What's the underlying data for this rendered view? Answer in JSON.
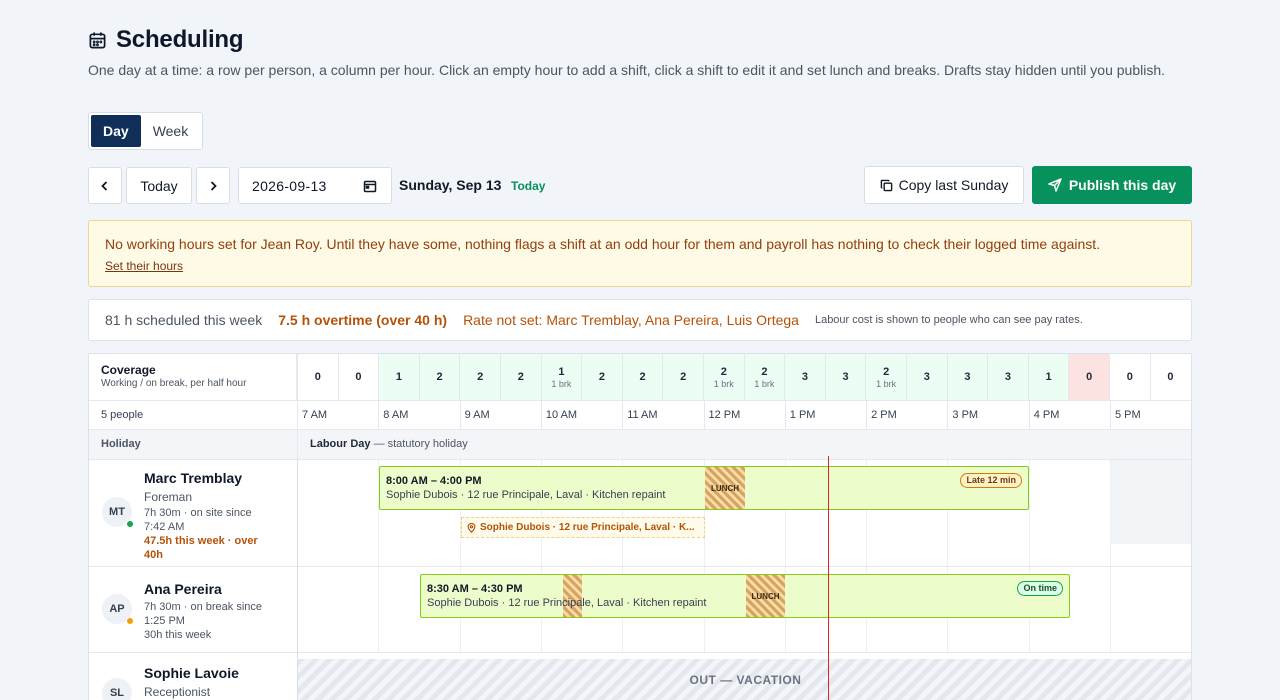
{
  "page": {
    "title": "Scheduling",
    "description": "One day at a time: a row per person, a column per hour. Click an empty hour to add a shift, click a shift to edit it and set lunch and breaks. Drafts stay hidden until you publish."
  },
  "view_toggle": {
    "day": "Day",
    "week": "Week",
    "selected": "Day"
  },
  "toolbar": {
    "today_label": "Today",
    "date_value": "2026-09-13",
    "date_label": "Sunday, Sep 13",
    "today_badge": "Today",
    "copy_label": "Copy last Sunday",
    "publish_label": "Publish this day"
  },
  "alert": {
    "message": "No working hours set for Jean Roy. Until they have some, nothing flags a shift at an odd hour for them and payroll has nothing to check their logged time against.",
    "link": "Set their hours"
  },
  "summary": {
    "scheduled": "81 h scheduled this week",
    "overtime": "7.5 h overtime (over 40 h)",
    "rate": "Rate not set: Marc Tremblay, Ana Pereira, Luis Ortega",
    "note": "Labour cost is shown to people who can see pay rates."
  },
  "coverage": {
    "title": "Coverage",
    "subtitle": "Working / on break, per half hour",
    "cells": [
      {
        "v": "0",
        "b": ""
      },
      {
        "v": "0",
        "b": ""
      },
      {
        "v": "1",
        "b": ""
      },
      {
        "v": "2",
        "b": ""
      },
      {
        "v": "2",
        "b": ""
      },
      {
        "v": "2",
        "b": ""
      },
      {
        "v": "1",
        "b": "1 brk"
      },
      {
        "v": "2",
        "b": ""
      },
      {
        "v": "2",
        "b": ""
      },
      {
        "v": "2",
        "b": ""
      },
      {
        "v": "2",
        "b": "1 brk"
      },
      {
        "v": "2",
        "b": "1 brk"
      },
      {
        "v": "3",
        "b": ""
      },
      {
        "v": "3",
        "b": ""
      },
      {
        "v": "2",
        "b": "1 brk"
      },
      {
        "v": "3",
        "b": ""
      },
      {
        "v": "3",
        "b": ""
      },
      {
        "v": "3",
        "b": ""
      },
      {
        "v": "1",
        "b": ""
      },
      {
        "v": "0",
        "b": ""
      },
      {
        "v": "0",
        "b": ""
      },
      {
        "v": "0",
        "b": ""
      }
    ]
  },
  "hours_header": {
    "people_count": "5 people",
    "hours": [
      "7 AM",
      "8 AM",
      "9 AM",
      "10 AM",
      "11 AM",
      "12 PM",
      "1 PM",
      "2 PM",
      "3 PM",
      "4 PM",
      "5 PM"
    ]
  },
  "holiday": {
    "label": "Holiday",
    "name": "Labour Day",
    "detail": " — statutory holiday"
  },
  "people": [
    {
      "initials": "MT",
      "name": "Marc Tremblay",
      "role": "Foreman",
      "status_line1": "7h 30m · on site since",
      "status_line2": "7:42 AM",
      "week_line1": "47.5h this week · over",
      "week_line2": "40h",
      "shift_time": "8:00 AM – 4:00 PM",
      "shift_detail": "Sophie Dubois · 12 rue Principale, Laval · Kitchen repaint",
      "lunch": "LUNCH",
      "badge": "Late 12 min",
      "ghost": "Sophie Dubois · 12 rue Principale, Laval · K..."
    },
    {
      "initials": "AP",
      "name": "Ana Pereira",
      "role": "",
      "status_line1": "7h 30m · on break since",
      "status_line2": "1:25 PM",
      "week_line1": "30h this week",
      "shift_time": "8:30 AM – 4:30 PM",
      "shift_detail": "Sophie Dubois · 12 rue Principale, Laval · Kitchen repaint",
      "lunch": "LUNCH",
      "badge": "On time"
    },
    {
      "initials": "SL",
      "name": "Sophie Lavoie",
      "role": "Receptionist",
      "out_label": "OUT — VACATION"
    }
  ],
  "colors": {
    "primary": "#0f2f58",
    "publish": "#07915c",
    "shift_fill": "#ecfccb",
    "shift_border": "#84cc16",
    "overtime": "#b45309",
    "now_line": "#dc2626"
  }
}
